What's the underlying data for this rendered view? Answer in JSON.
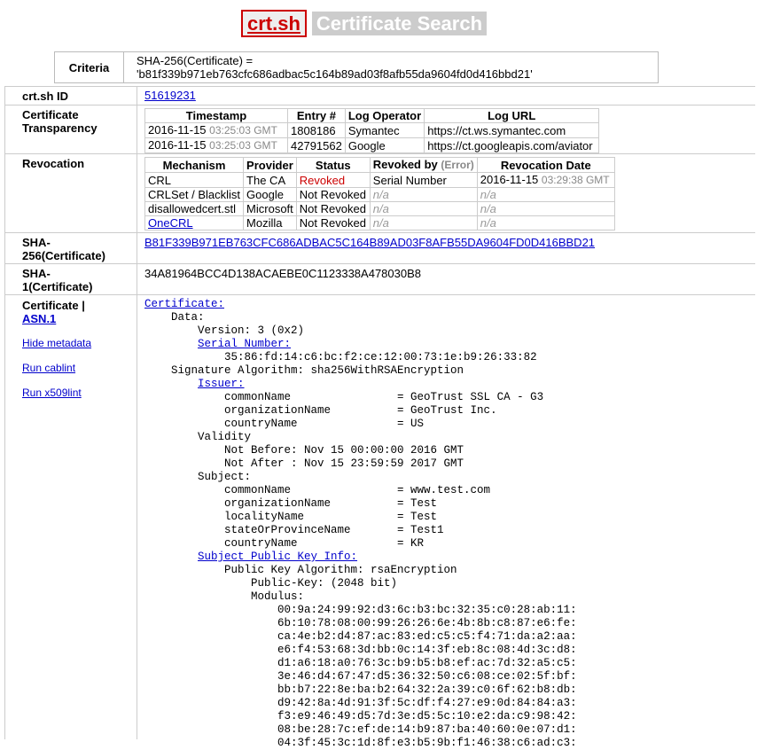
{
  "header": {
    "logo": "crt.sh",
    "subtitle": "Certificate Search"
  },
  "criteria": {
    "label": "Criteria",
    "value": "SHA-256(Certificate) = 'b81f339b971eb763cfc686adbac5c164b89ad03f8afb55da9604fd0d416bbd21'"
  },
  "rows": {
    "id_label": "crt.sh ID",
    "id_value": "51619231",
    "ct_label": "Certificate Transparency",
    "rev_label": "Revocation",
    "sha256_label": "SHA-256(Certificate)",
    "sha256_value": "B81F339B971EB763CFC686ADBAC5C164B89AD03F8AFB55DA9604FD0D416BBD21",
    "sha1_label": "SHA-1(Certificate)",
    "sha1_value": "34A81964BCC4D138ACAEBE0C1123338A478030B8",
    "cert_label": "Certificate |",
    "asn1_link": "ASN.1",
    "hide_metadata": "Hide metadata",
    "run_cablint": "Run cablint",
    "run_x509lint": "Run x509lint"
  },
  "ct": {
    "headers": [
      "Timestamp",
      "Entry #",
      "Log Operator",
      "Log URL"
    ],
    "rows": [
      {
        "date": "2016-11-15",
        "time": "03:25:03 GMT",
        "entry": "1808186",
        "operator": "Symantec",
        "url": "https://ct.ws.symantec.com"
      },
      {
        "date": "2016-11-15",
        "time": "03:25:03 GMT",
        "entry": "42791562",
        "operator": "Google",
        "url": "https://ct.googleapis.com/aviator"
      }
    ]
  },
  "revocation": {
    "headers": {
      "mechanism": "Mechanism",
      "provider": "Provider",
      "status": "Status",
      "revoked_by": "Revoked by",
      "error": "(Error)",
      "date": "Revocation Date"
    },
    "rows": [
      {
        "mechanism": "CRL",
        "provider": "The CA",
        "status": "Revoked",
        "revoked_by": "Serial Number",
        "date": "2016-11-15",
        "time": "03:29:38 GMT"
      },
      {
        "mechanism": "CRLSet / Blacklist",
        "provider": "Google",
        "status": "Not Revoked",
        "revoked_by": "n/a",
        "date": "n/a"
      },
      {
        "mechanism": "disallowedcert.stl",
        "provider": "Microsoft",
        "status": "Not Revoked",
        "revoked_by": "n/a",
        "date": "n/a"
      },
      {
        "mechanism": "OneCRL",
        "provider": "Mozilla",
        "status": "Not Revoked",
        "revoked_by": "n/a",
        "date": "n/a"
      }
    ]
  },
  "cert": {
    "certificate_link": "Certificate:",
    "data": "    Data:",
    "version": "        Version: 3 (0x2)",
    "serial_link": "Serial Number:",
    "serial": "            35:86:fd:14:c6:bc:f2:ce:12:00:73:1e:b9:26:33:82",
    "sig_alg": "    Signature Algorithm: sha256WithRSAEncryption",
    "issuer_link": "Issuer:",
    "issuer": "            commonName                = GeoTrust SSL CA - G3\n            organizationName          = GeoTrust Inc.\n            countryName               = US",
    "validity": "        Validity\n            Not Before: Nov 15 00:00:00 2016 GMT\n            Not After : Nov 15 23:59:59 2017 GMT\n        Subject:",
    "subject": "            commonName                = www.test.com\n            organizationName          = Test\n            localityName              = Test\n            stateOrProvinceName       = Test1\n            countryName               = KR",
    "spki_link": "Subject Public Key Info:",
    "pubkey": "            Public Key Algorithm: rsaEncryption\n                Public-Key: (2048 bit)\n                Modulus:\n                    00:9a:24:99:92:d3:6c:b3:bc:32:35:c0:28:ab:11:\n                    6b:10:78:08:00:99:26:26:6e:4b:8b:c8:87:e6:fe:\n                    ca:4e:b2:d4:87:ac:83:ed:c5:c5:f4:71:da:a2:aa:\n                    e6:f4:53:68:3d:bb:0c:14:3f:eb:8c:08:4d:3c:d8:\n                    d1:a6:18:a0:76:3c:b9:b5:b8:ef:ac:7d:32:a5:c5:\n                    3e:46:d4:67:47:d5:36:32:50:c6:08:ce:02:5f:bf:\n                    bb:b7:22:8e:ba:b2:64:32:2a:39:c0:6f:62:b8:db:\n                    d9:42:8a:4d:91:3f:5c:df:f4:27:e9:0d:84:84:a3:\n                    f3:e9:46:49:d5:7d:3e:d5:5c:10:e2:da:c9:98:42:\n                    08:be:28:7c:ef:de:14:b9:87:ba:40:60:0e:07:d1:\n                    04:3f:45:3c:1d:8f:e3:b5:9b:f1:46:38:c6:ad:c3:"
  }
}
